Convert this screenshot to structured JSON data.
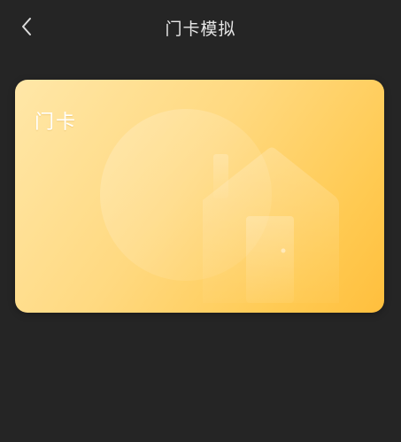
{
  "header": {
    "title": "门卡模拟",
    "back_icon": "chevron-left-icon"
  },
  "card": {
    "label": "门卡",
    "illustration": "house-icon",
    "colors": {
      "gradient_start": "#ffe7a8",
      "gradient_end": "#ffbf3d"
    }
  },
  "theme": {
    "background": "#252525",
    "text": "#e6e6e6"
  }
}
